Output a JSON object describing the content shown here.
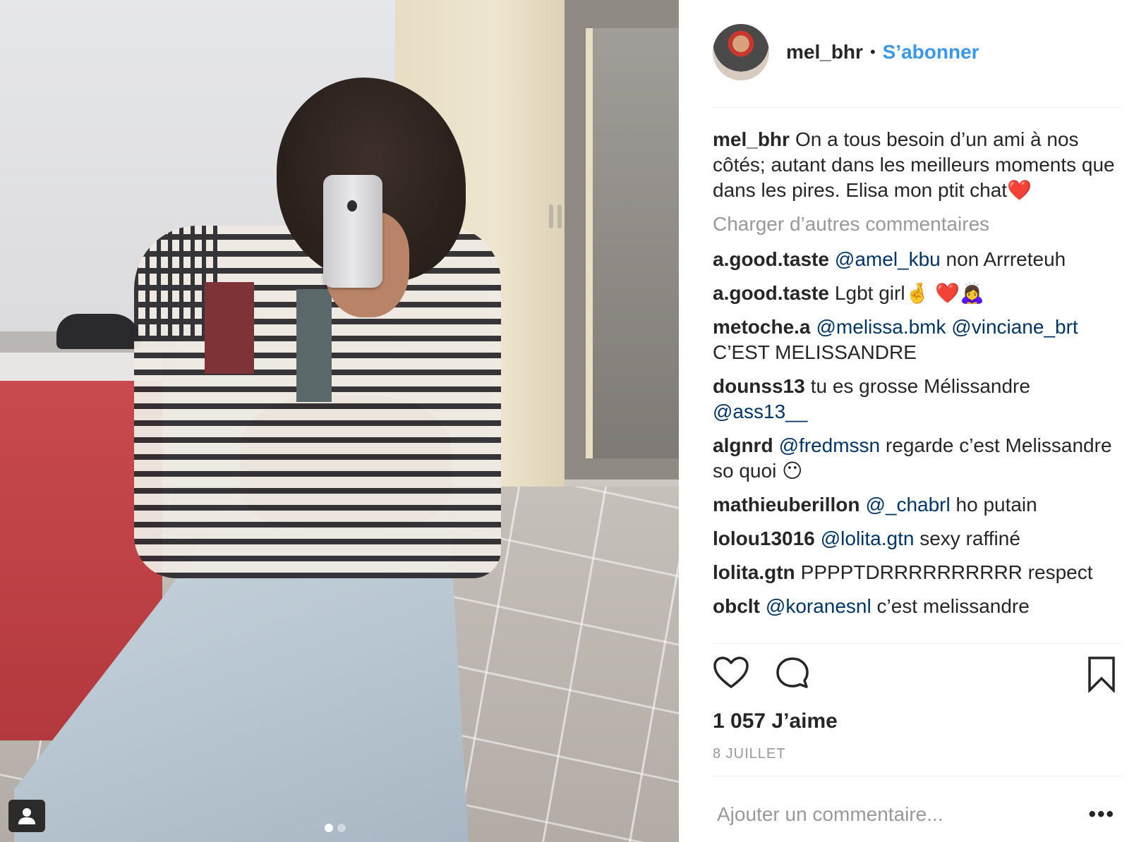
{
  "post": {
    "username": "mel_bhr",
    "separator": "•",
    "follow_label": "S’abonner",
    "caption": {
      "author": "mel_bhr",
      "text": "On a tous besoin d’un ami à nos côtés; autant dans les meilleurs moments que dans les pires. Elisa mon ptit chat❤️"
    },
    "load_more_label": "Charger d’autres commentaires",
    "comments": [
      {
        "author": "a.good.taste",
        "mention": "@amel_kbu",
        "text": " non Arrreteuh",
        "mention2": "",
        "text2": ""
      },
      {
        "author": "a.good.taste",
        "mention": "",
        "text": "Lgbt girl🤞 ❤️🙇‍♀️",
        "mention2": "",
        "text2": ""
      },
      {
        "author": "metoche.a",
        "mention": "@melissa.bmk",
        "text": " ",
        "mention2": "@vinciane_brt",
        "text2": " C’EST MELISSANDRE"
      },
      {
        "author": "dounss13",
        "mention": "",
        "text": "tu es grosse Mélissandre ",
        "mention2": "@ass13__",
        "text2": ""
      },
      {
        "author": "algnrd",
        "mention": "@fredmssn",
        "text": " regarde c’est Melissandre so quoi 😶",
        "mention2": "",
        "text2": ""
      },
      {
        "author": "mathieuberillon",
        "mention": "@_chabrl",
        "text": " ho putain",
        "mention2": "",
        "text2": ""
      },
      {
        "author": "lolou13016",
        "mention": "@lolita.gtn",
        "text": " sexy raffiné",
        "mention2": "",
        "text2": ""
      },
      {
        "author": "lolita.gtn",
        "mention": "",
        "text": "PPPPTDRRRRRRRRRR respect",
        "mention2": "",
        "text2": ""
      },
      {
        "author": "obclt",
        "mention": "@koranesnl",
        "text": " c’est melissandre",
        "mention2": "",
        "text2": ""
      }
    ],
    "likes_label": "1 057 J’aime",
    "date_label": "8 JUILLET",
    "comment_placeholder": "Ajouter un commentaire...",
    "more_label": "•••",
    "carousel": {
      "count": 2,
      "active_index": 0
    }
  },
  "icons": {
    "like": "heart-icon",
    "comment": "speech-bubble-icon",
    "save": "bookmark-icon",
    "user_tag": "person-icon"
  },
  "colors": {
    "link_blue": "#3897f0",
    "mention_blue": "#003569",
    "muted_gray": "#999999",
    "text": "#262626",
    "divider": "#efefef"
  }
}
